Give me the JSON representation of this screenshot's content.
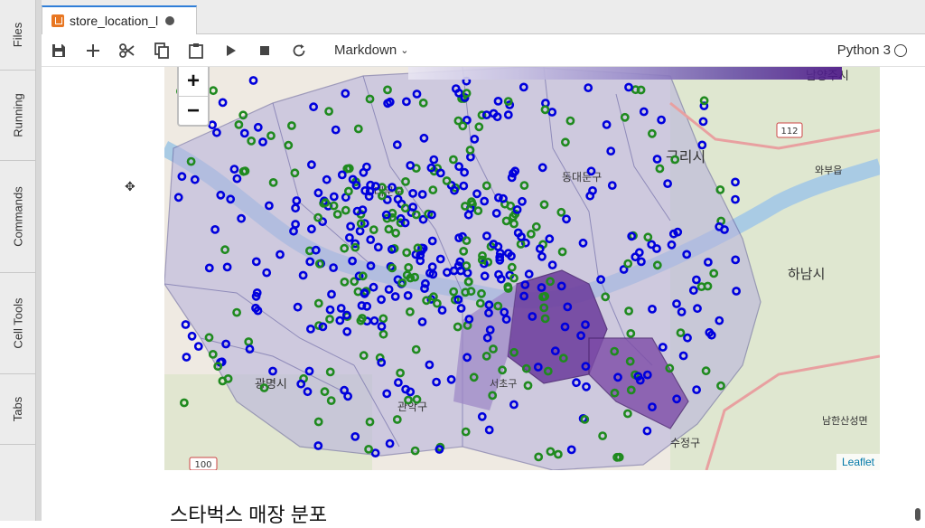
{
  "sidebar": {
    "tabs": [
      {
        "label": "Files"
      },
      {
        "label": "Running"
      },
      {
        "label": "Commands"
      },
      {
        "label": "Cell Tools"
      },
      {
        "label": "Tabs"
      }
    ]
  },
  "document_tab": {
    "title": "store_location_l"
  },
  "toolbar": {
    "cell_type": "Markdown",
    "kernel": "Python 3",
    "icons": [
      "save-icon",
      "add-cell-icon",
      "cut-icon",
      "copy-icon",
      "paste-icon",
      "run-icon",
      "stop-icon",
      "restart-icon"
    ]
  },
  "map": {
    "zoom_in": "+",
    "zoom_out": "−",
    "attribution": "Leaflet",
    "labels": {
      "guri": "구리시",
      "hanam": "하남시",
      "gwangmyeong": "광명시",
      "sujeong": "수정구",
      "namhansan": "남한산성면",
      "gwanak": "관악구",
      "seodaemun": "대문구",
      "dongdaemun": "동대문구",
      "wabu": "와부읍",
      "seocho": "서초구",
      "yangju": "남양주시",
      "road_112": "112",
      "road_100": "100"
    },
    "colors": {
      "series_a": "#0000dd",
      "series_b": "#1f8a1f",
      "choropleth_dark": "#5b2a8c",
      "choropleth_light": "#c8c3e3"
    }
  },
  "notebook": {
    "markdown_heading": "스타벅스 매장 분포"
  }
}
